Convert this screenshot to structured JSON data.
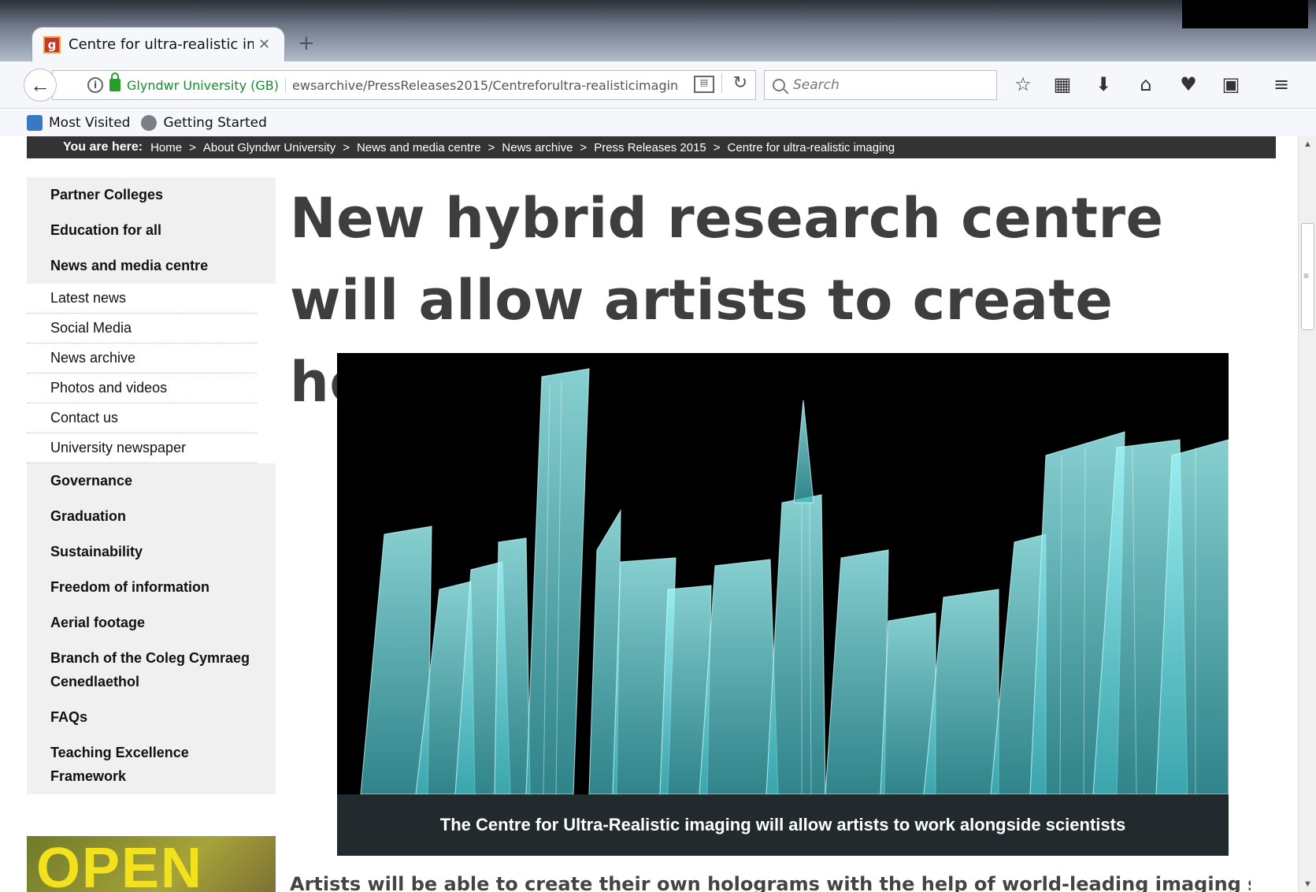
{
  "browser": {
    "tab_title": "Centre for ultra-realistic imag",
    "tab_close": "✕",
    "new_tab": "+",
    "identity": "Glyndwr University (GB)",
    "url": "ewsarchive/PressReleases2015/Centreforultra-realisticimaging",
    "search_placeholder": "Search",
    "bookmarks": [
      "Most Visited",
      "Getting Started"
    ]
  },
  "breadcrumb": {
    "label": "You are here:",
    "items": [
      "Home",
      "About Glyndwr University",
      "News and media centre",
      "News archive",
      "Press Releases 2015",
      "Centre for ultra-realistic imaging"
    ],
    "separator": ">"
  },
  "sidebar": {
    "top_items": [
      "Partner Colleges",
      "Education for all",
      "News and media centre"
    ],
    "sub_items": [
      "Latest news",
      "Social Media",
      "News archive",
      "Photos and videos",
      "Contact us",
      "University newspaper"
    ],
    "bottom_items": [
      "Governance",
      "Graduation",
      "Sustainability",
      "Freedom of information",
      "Aerial footage",
      "Branch of the Coleg Cymraeg Cenedlaethol",
      "FAQs",
      "Teaching Excellence Framework"
    ],
    "promo_text": "OPEN"
  },
  "article": {
    "headline": "New hybrid research centre will allow artists to create holograms",
    "image_caption": "The Centre for Ultra-Realistic imaging will allow artists to work alongside scientists",
    "intro": "Artists will be able to create their own holograms with the help of world-leading imaging scientists at a"
  },
  "colors": {
    "breadcrumb_bg": "#333333",
    "sidebar_bg": "#f0f0f0",
    "headline": "#3e3e3e",
    "hologram": "#7fe3e6",
    "identity_green": "#0f8f2d"
  }
}
